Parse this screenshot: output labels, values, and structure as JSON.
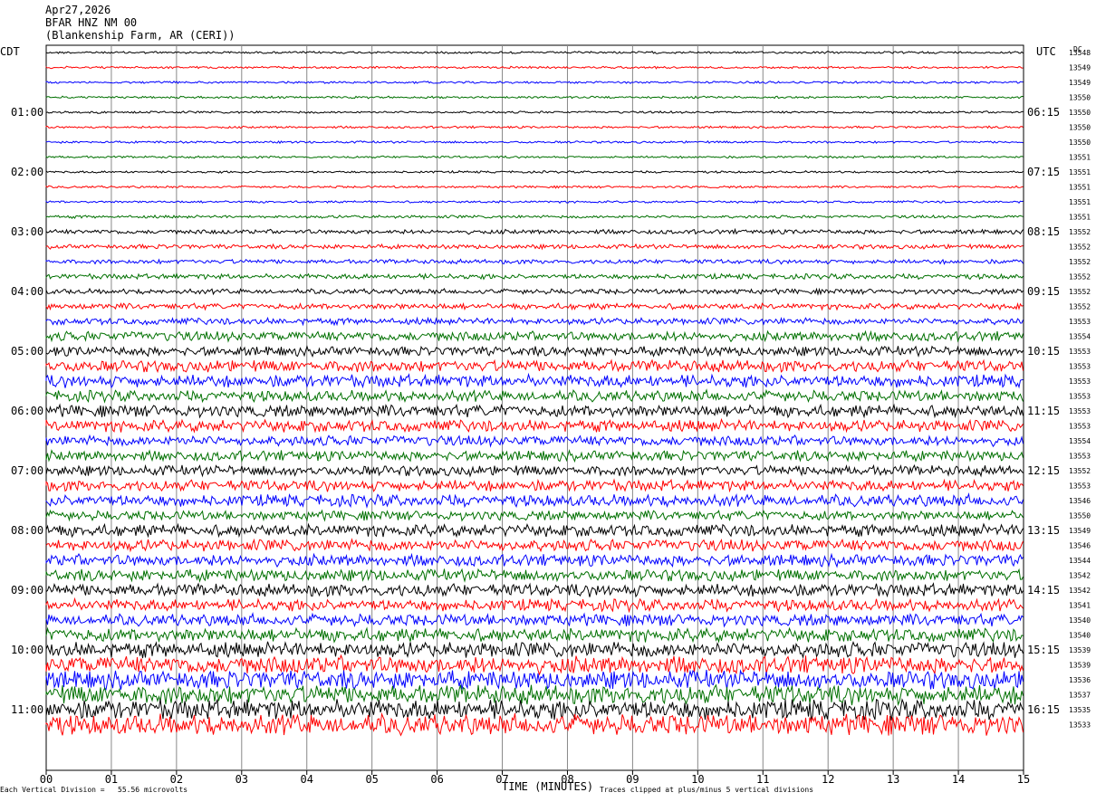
{
  "header": {
    "date": "Apr27,2026",
    "station": "BFAR HNZ NM 00",
    "site": "(Blankenship Farm, AR (CERI))"
  },
  "tz_left": "CDT",
  "tz_right": "UTC",
  "dc_label": "DC",
  "chart_data": {
    "type": "line",
    "title": "",
    "xlabel": "TIME (MINUTES)",
    "x_ticks": [
      "00",
      "01",
      "02",
      "03",
      "04",
      "05",
      "06",
      "07",
      "08",
      "09",
      "10",
      "11",
      "12",
      "13",
      "14",
      "15"
    ],
    "xlim": [
      0,
      15
    ],
    "trace_colors": [
      "#000000",
      "#ff0000",
      "#0000ff",
      "#007000"
    ],
    "left_hour_labels": [
      "01:00",
      "02:00",
      "03:00",
      "04:00",
      "05:00",
      "06:00",
      "07:00",
      "08:00",
      "09:00",
      "10:00",
      "11:00"
    ],
    "right_hour_labels": [
      "06:15",
      "07:15",
      "08:15",
      "09:15",
      "10:15",
      "11:15",
      "12:15",
      "13:15",
      "14:15",
      "15:15",
      "16:15"
    ],
    "dc_offsets": [
      "13548",
      "13549",
      "13549",
      "13550",
      "13550",
      "13550",
      "13550",
      "13551",
      "13551",
      "13551",
      "13551",
      "13551",
      "13552",
      "13552",
      "13552",
      "13552",
      "13552",
      "13552",
      "13553",
      "13554",
      "13553",
      "13553",
      "13553",
      "13553",
      "13553",
      "13553",
      "13554",
      "13553",
      "13552",
      "13553",
      "13546",
      "13550",
      "13549",
      "13546",
      "13544",
      "13542",
      "13542",
      "13541",
      "13540",
      "13540",
      "13539",
      "13539",
      "13536",
      "13537",
      "13535",
      "13533"
    ],
    "trace_amplitude": [
      0.3,
      0.3,
      0.3,
      0.3,
      0.3,
      0.3,
      0.3,
      0.3,
      0.3,
      0.3,
      0.3,
      0.4,
      0.6,
      0.6,
      0.6,
      0.7,
      0.7,
      0.8,
      0.9,
      1.3,
      1.3,
      1.6,
      1.7,
      1.5,
      1.6,
      1.6,
      1.4,
      1.4,
      1.4,
      1.5,
      1.6,
      1.3,
      1.6,
      1.6,
      1.6,
      1.6,
      1.7,
      1.6,
      1.6,
      1.8,
      2.1,
      2.4,
      2.5,
      2.6,
      2.7,
      2.8
    ]
  },
  "footer": {
    "scale": "Each Vertical Division =   55.56 microvolts",
    "clip_note": "Traces clipped at plus/minus 5 vertical divisions"
  }
}
